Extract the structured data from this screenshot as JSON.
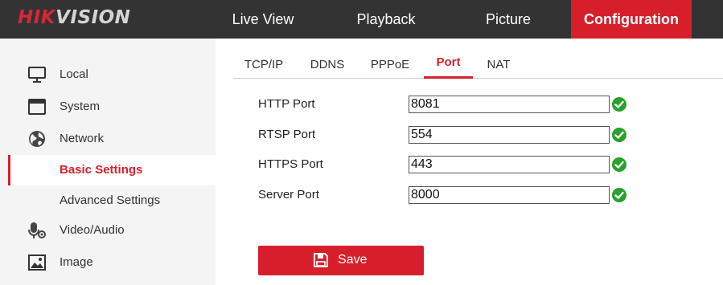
{
  "brand": {
    "logo_red": "HIK",
    "logo_grey": "VISION",
    "accent_color": "#d71f2b",
    "success_color": "#27a22b"
  },
  "top_nav": {
    "items": [
      {
        "label": "Live View"
      },
      {
        "label": "Playback"
      },
      {
        "label": "Picture"
      },
      {
        "label": "Configuration",
        "active": true
      }
    ]
  },
  "sidebar": {
    "items": [
      {
        "label": "Local",
        "icon": "monitor-icon"
      },
      {
        "label": "System",
        "icon": "window-icon"
      },
      {
        "label": "Network",
        "icon": "globe-icon"
      },
      {
        "label": "Basic Settings",
        "active": true
      },
      {
        "label": "Advanced Settings"
      },
      {
        "label": "Video/Audio",
        "icon": "microphone-icon"
      },
      {
        "label": "Image",
        "icon": "image-icon"
      }
    ]
  },
  "tabs": [
    {
      "label": "TCP/IP"
    },
    {
      "label": "DDNS"
    },
    {
      "label": "PPPoE"
    },
    {
      "label": "Port",
      "active": true
    },
    {
      "label": "NAT"
    }
  ],
  "ports": [
    {
      "label": "HTTP Port",
      "value": "8081",
      "valid": true
    },
    {
      "label": "RTSP Port",
      "value": "554",
      "valid": true
    },
    {
      "label": "HTTPS Port",
      "value": "443",
      "valid": true
    },
    {
      "label": "Server Port",
      "value": "8000",
      "valid": true
    }
  ],
  "actions": {
    "save_label": "Save",
    "save_icon": "floppy-disk-icon"
  }
}
